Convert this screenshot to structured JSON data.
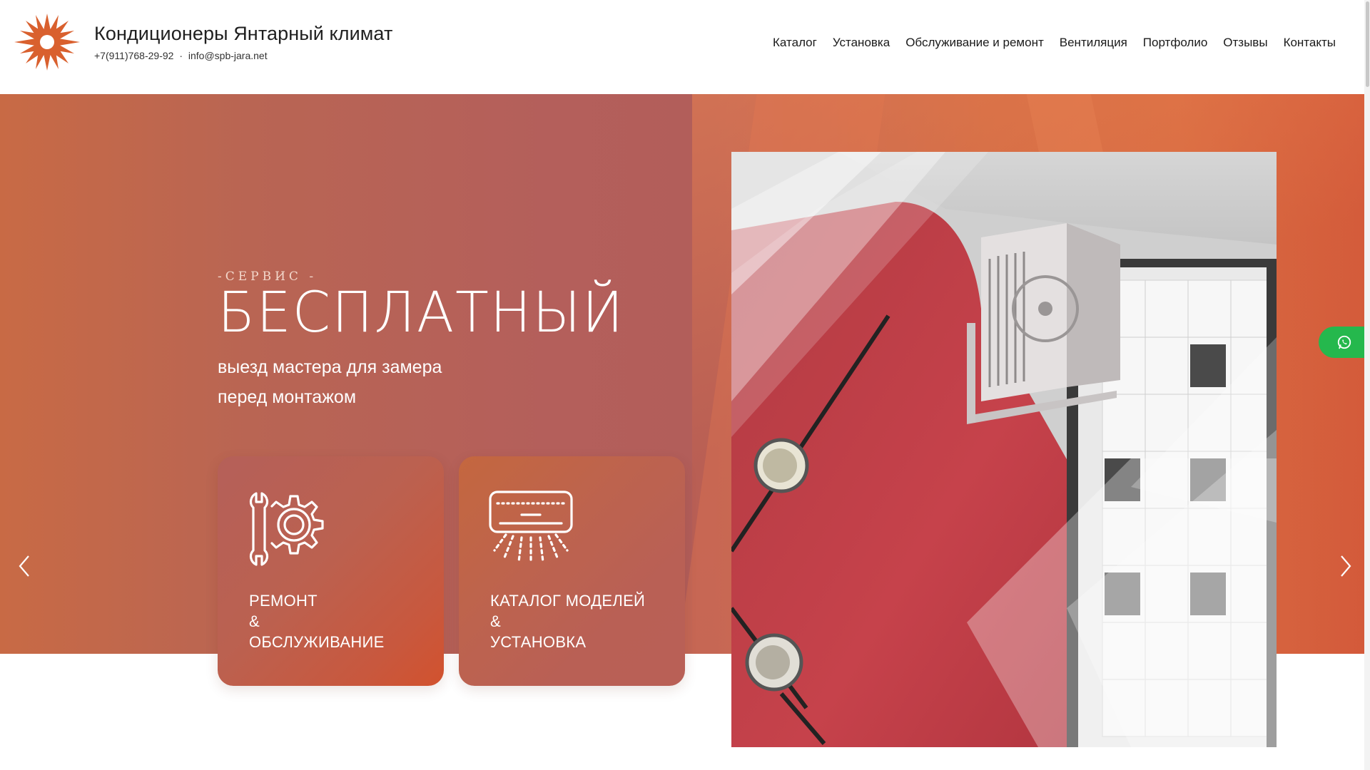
{
  "header": {
    "title": "Кондиционеры Янтарный климат",
    "phone": "+7(911)768-29-92",
    "separator": "·",
    "email": "info@spb-jara.net",
    "logo_icon": "sun-logo-icon",
    "brand_color": "#d9602e"
  },
  "nav": {
    "items": [
      {
        "label": "Каталог"
      },
      {
        "label": "Установка"
      },
      {
        "label": "Обслуживание и ремонт"
      },
      {
        "label": "Вентиляция"
      },
      {
        "label": "Портфолио"
      },
      {
        "label": "Отзывы"
      },
      {
        "label": "Контакты"
      }
    ]
  },
  "hero": {
    "eyebrow": "-СЕРВИС -",
    "title": "БЕСПЛАТНЫЙ",
    "subtitle_line1": "выезд мастера для замера",
    "subtitle_line2": "перед монтажом",
    "prev_icon": "chevron-left-icon",
    "next_icon": "chevron-right-icon"
  },
  "cards": [
    {
      "icon": "wrench-gear-icon",
      "line1": "РЕМОНТ",
      "line2": "&",
      "line3": "ОБСЛУЖИВАНИЕ"
    },
    {
      "icon": "air-conditioner-icon",
      "line1": "КАТАЛОГ МОДЕЛЕЙ",
      "line2": "&",
      "line3": "УСТАНОВКА"
    }
  ],
  "whatsapp": {
    "icon": "whatsapp-icon",
    "color": "#25b84d"
  }
}
